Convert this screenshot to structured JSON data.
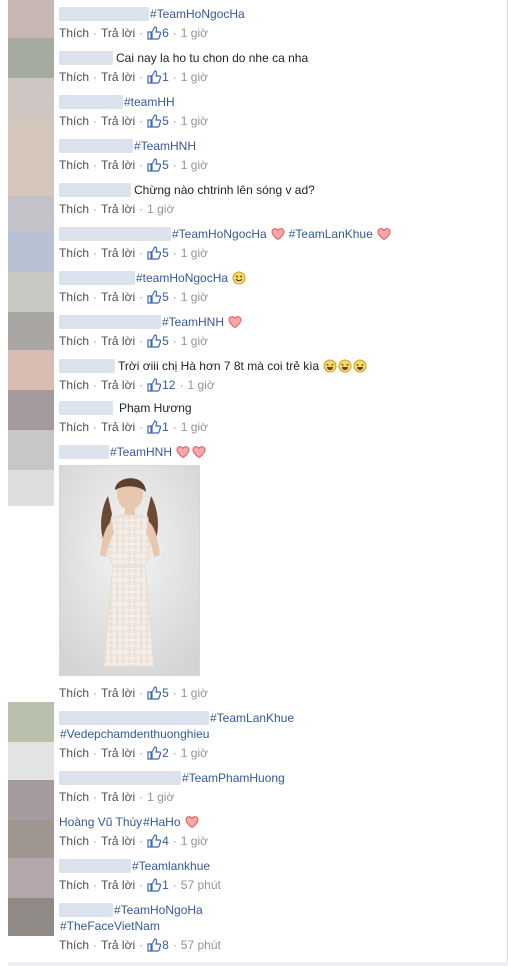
{
  "actions": {
    "like": "Thích",
    "reply": "Trả lời",
    "sep": "·"
  },
  "comments": [
    {
      "tag": "#TeamHoNgocHa",
      "likes": "6",
      "time": "1 giờ"
    },
    {
      "text": "Cai nay la ho tu chon do nhe ca nha",
      "likes": "1",
      "time": "1 giờ"
    },
    {
      "tag": "#teamHH",
      "likes": "5",
      "time": "1 giờ"
    },
    {
      "tag": "#TeamHNH",
      "likes": "5",
      "time": "1 giờ"
    },
    {
      "text": "Chừng nào chtrinh lên sóng v ad?",
      "time": "1 giờ"
    },
    {
      "tag1": "#TeamHoNgocHa",
      "tag2": "#TeamLanKhue",
      "likes": "5",
      "time": "1 giờ"
    },
    {
      "tag": "#teamHoNgocHa",
      "likes": "5",
      "time": "1 giờ"
    },
    {
      "tag": "#TeamHNH",
      "likes": "5",
      "time": "1 giờ"
    },
    {
      "text": "Trời ơiii chị Hà hơn 7 8t mà coi trẻ kìa",
      "likes": "12",
      "time": "1 giờ"
    },
    {
      "text": "Phạm Hương",
      "likes": "1",
      "time": "1 giờ"
    },
    {
      "tag": "#TeamHNH",
      "likes": "5",
      "time": "1 giờ"
    },
    {
      "tag": "#TeamLanKhue",
      "tag2": "#Vedepchamdenthuonghieu",
      "likes": "2",
      "time": "1 giờ"
    },
    {
      "tag": "#TeamPhamHuong",
      "time": "1 giờ"
    },
    {
      "name": "Hoàng Vũ Thúy",
      "tag": "#HaHo",
      "likes": "4",
      "time": "1 giờ"
    },
    {
      "tag": "#Teamlankhue",
      "likes": "1",
      "time": "57 phút"
    },
    {
      "tag": "#TeamHoNgoHa",
      "tag2": "#TheFaceVietNam",
      "likes": "8",
      "time": "57 phút"
    }
  ],
  "colors": {
    "link": "#365899",
    "meta": "#90949c",
    "heart": "#e8585d",
    "like": "#4267b2"
  }
}
